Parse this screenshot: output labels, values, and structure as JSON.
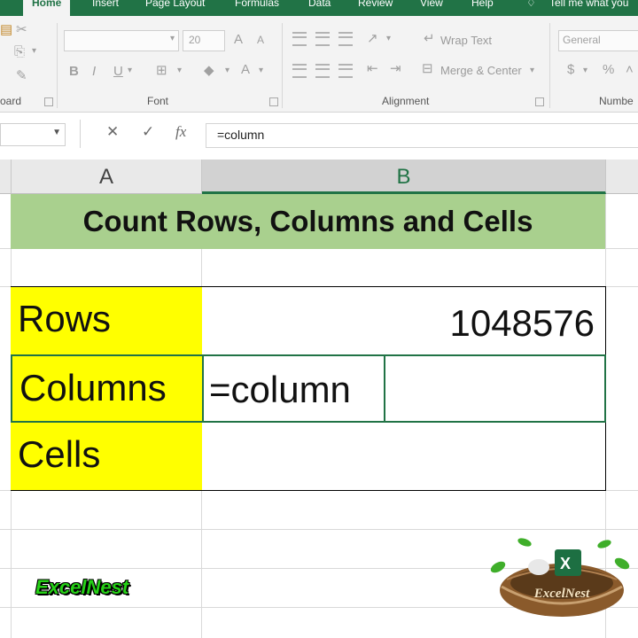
{
  "ribbon": {
    "tabs": [
      {
        "label": "Home",
        "active": true
      },
      {
        "label": "Insert"
      },
      {
        "label": "Page Layout"
      },
      {
        "label": "Formulas"
      },
      {
        "label": "Data"
      },
      {
        "label": "Review"
      },
      {
        "label": "View"
      },
      {
        "label": "Help"
      },
      {
        "label": "Tell me what you"
      }
    ],
    "groups": {
      "clipboard": "oard",
      "font": "Font",
      "alignment": "Alignment",
      "number": "Numbe"
    },
    "font_size": "20",
    "wrap_text": "Wrap Text",
    "merge_center": "Merge & Center",
    "number_format": "General",
    "bold": "B",
    "italic": "I",
    "underline": "U",
    "grow_font": "A",
    "shrink_font": "A",
    "currency": "$",
    "percent": "%"
  },
  "formula_bar": {
    "content": "=column",
    "cancel_glyph": "✕",
    "enter_glyph": "✓",
    "fx_glyph": "fx"
  },
  "columns": [
    {
      "label": "A"
    },
    {
      "label": "B",
      "selected": true
    }
  ],
  "sheet": {
    "title": "Count Rows, Columns and Cells",
    "rows": [
      {
        "label": "Rows",
        "value": "1048576"
      },
      {
        "label": "Columns",
        "value": "=column"
      },
      {
        "label": "Cells",
        "value": ""
      }
    ]
  },
  "watermark": {
    "brand": "ExcelNest",
    "logo_text": "ExcelNest"
  },
  "colors": {
    "accent": "#217346",
    "title_fill": "#a9d08e",
    "label_fill": "#ffff00",
    "brand_green": "#25d016"
  }
}
